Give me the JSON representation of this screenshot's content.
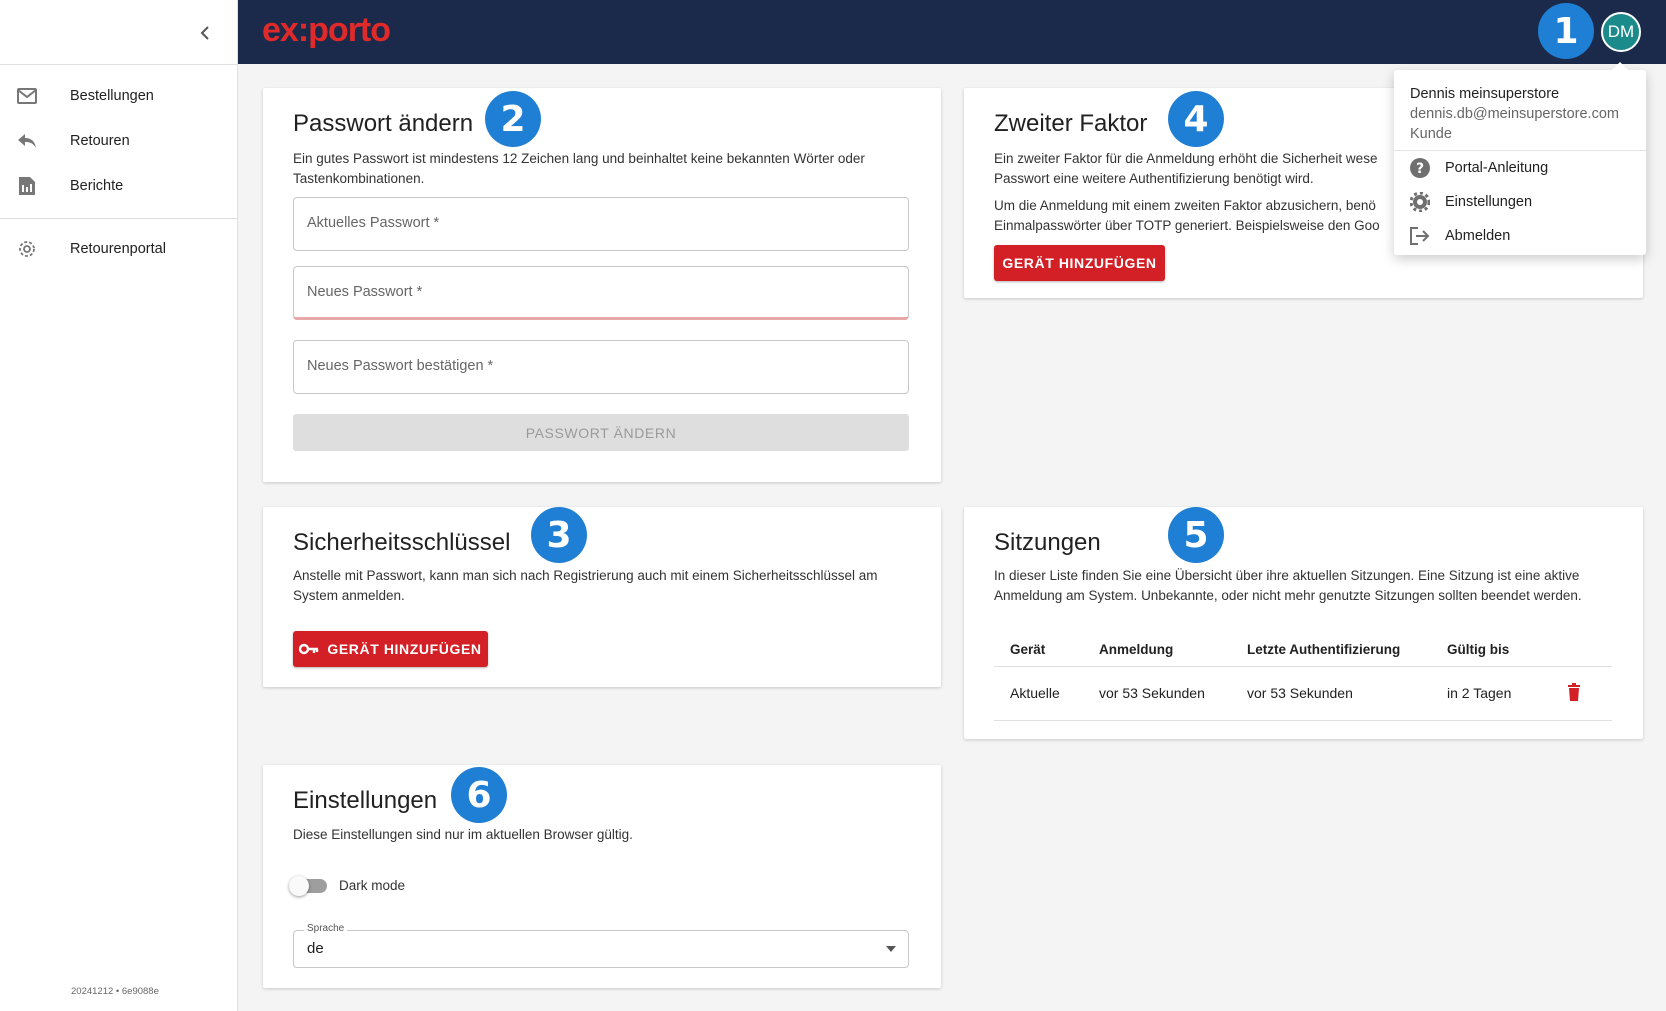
{
  "brand": {
    "logo_left": "ex",
    "logo_mid": ":",
    "logo_right": "porto"
  },
  "user": {
    "initials": "DM"
  },
  "sidebar": {
    "items": [
      {
        "label": "Bestellungen",
        "icon": "mail-icon"
      },
      {
        "label": "Retouren",
        "icon": "reply-icon"
      },
      {
        "label": "Berichte",
        "icon": "report-icon"
      },
      {
        "label": "Retourenportal",
        "icon": "gear-icon"
      }
    ],
    "version": "20241212 • 6e9088e"
  },
  "badges": [
    "1",
    "2",
    "3",
    "4",
    "5",
    "6"
  ],
  "password_card": {
    "title": "Passwort ändern",
    "description": "Ein gutes Passwort ist mindestens 12 Zeichen lang und beinhaltet keine bekannten Wörter oder Tastenkombinationen.",
    "current_placeholder": "Aktuelles Passwort *",
    "new_placeholder": "Neues Passwort *",
    "confirm_placeholder": "Neues Passwort bestätigen *",
    "submit_label": "PASSWORT ÄNDERN"
  },
  "security_key_card": {
    "title": "Sicherheitsschlüssel",
    "description": "Anstelle mit Passwort, kann man sich nach Registrierung auch mit einem Sicherheitsschlüssel am System anmelden.",
    "button_label": "GERÄT HINZUFÜGEN"
  },
  "settings_card": {
    "title": "Einstellungen",
    "description": "Diese Einstellungen sind nur im aktuellen Browser gültig.",
    "dark_mode_label": "Dark mode",
    "dark_mode_on": false,
    "language_label": "Sprache",
    "language_value": "de"
  },
  "second_factor_card": {
    "title": "Zweiter Faktor",
    "description1": "Ein zweiter Faktor für die Anmeldung erhöht die Sicherheit wese",
    "description2": "Passwort eine weitere Authentifizierung benötigt wird.",
    "description3": "Um die Anmeldung mit einem zweiten Faktor abzusichern, benö",
    "description4": "Einmalpasswörter über TOTP generiert. Beispielsweise den Goo",
    "button_label": "GERÄT HINZUFÜGEN"
  },
  "sessions_card": {
    "title": "Sitzungen",
    "description": "In dieser Liste finden Sie eine Übersicht über ihre aktuellen Sitzungen. Eine Sitzung ist eine aktive Anmeldung am System. Unbekannte, oder nicht mehr genutzte Sitzungen sollten beendet werden.",
    "columns": [
      "Gerät",
      "Anmeldung",
      "Letzte Authentifizierung",
      "Gültig bis"
    ],
    "rows": [
      {
        "device": "Aktuelle",
        "login": "vor 53 Sekunden",
        "last_auth": "vor 53 Sekunden",
        "valid_until": "in 2 Tagen"
      }
    ]
  },
  "user_menu": {
    "name": "Dennis meinsuperstore",
    "email": "dennis.db@meinsuperstore.com",
    "role": "Kunde",
    "items": [
      {
        "label": "Portal-Anleitung",
        "icon": "help-icon"
      },
      {
        "label": "Einstellungen",
        "icon": "gear-icon"
      },
      {
        "label": "Abmelden",
        "icon": "logout-icon"
      }
    ]
  },
  "colors": {
    "topbar": "#1b2a4a",
    "accent_red": "#d31f26",
    "badge_blue": "#1f7fd4",
    "avatar": "#1b8a8a"
  }
}
